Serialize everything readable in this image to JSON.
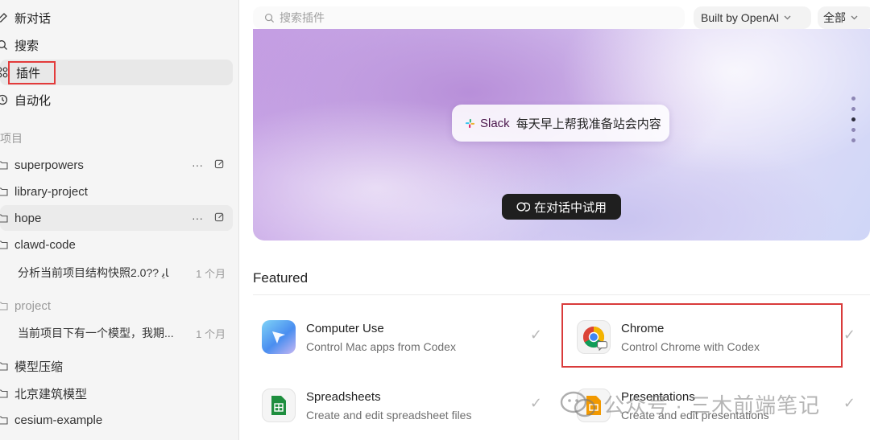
{
  "sidebar": {
    "nav": [
      {
        "label": "新对话",
        "icon": "edit-icon"
      },
      {
        "label": "搜索",
        "icon": "search-icon"
      },
      {
        "label": "插件",
        "icon": "grid-icon"
      },
      {
        "label": "自动化",
        "icon": "clock-icon"
      }
    ],
    "projects_label": "项目",
    "projects": [
      {
        "label": "superpowers"
      },
      {
        "label": "library-project"
      },
      {
        "label": "hope"
      },
      {
        "label": "clawd-code"
      },
      {
        "label": "project"
      },
      {
        "label": "模型压缩"
      },
      {
        "label": "北京建筑模型"
      },
      {
        "label": "cesium-example"
      }
    ],
    "threads": [
      {
        "title": "分析当前项目结构快照2.0?? ﺎﯾ",
        "time": "1 个月"
      },
      {
        "title": "当前项目下有一个模型，我期...",
        "time": "1 个月"
      }
    ],
    "more_icon": "···"
  },
  "toolbar": {
    "search_placeholder": "搜索插件",
    "filter_builder": "Built by OpenAI",
    "filter_category": "全部"
  },
  "hero": {
    "slack_label": "Slack",
    "prompt": "每天早上帮我准备站会内容",
    "try_button": "在对话中试用",
    "slide_count": 5,
    "active_slide": 2
  },
  "featured": {
    "title": "Featured",
    "plugins": [
      {
        "name": "Computer Use",
        "desc": "Control Mac apps from Codex",
        "icon": "computer-use-icon"
      },
      {
        "name": "Chrome",
        "desc": "Control Chrome with Codex",
        "icon": "chrome-icon"
      },
      {
        "name": "Spreadsheets",
        "desc": "Create and edit spreadsheet files",
        "icon": "spreadsheet-icon"
      },
      {
        "name": "Presentations",
        "desc": "Create and edit presentations",
        "icon": "presentation-icon"
      }
    ],
    "installed_mark": "✓"
  },
  "watermark": {
    "text": "公众号 · 三木前端笔记"
  },
  "colors": {
    "annotation": "#d93b3b",
    "sidebar_bg": "#f5f5f5",
    "button_dark": "#1f1f1f"
  }
}
